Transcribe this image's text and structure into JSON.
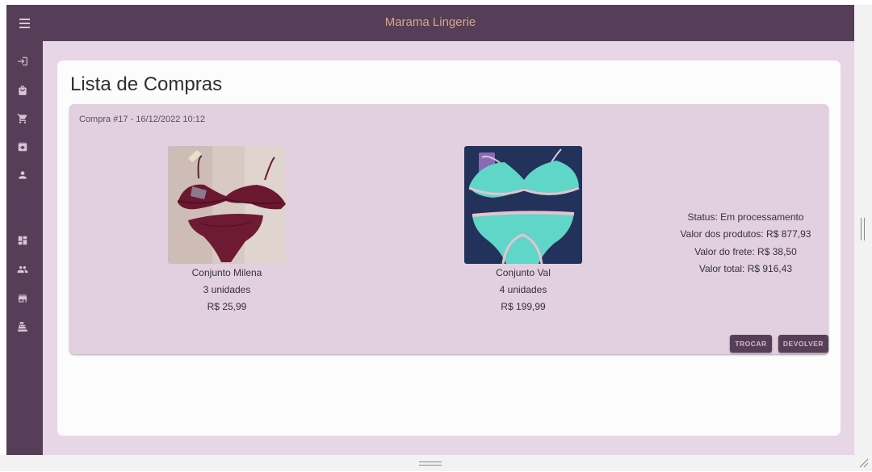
{
  "app": {
    "title": "Marama Lingerie"
  },
  "sidebar": {
    "items": [
      {
        "icon": "login-icon"
      },
      {
        "icon": "shopping-bag-icon"
      },
      {
        "icon": "cart-icon"
      },
      {
        "icon": "archive-icon"
      },
      {
        "icon": "person-icon"
      },
      {
        "icon": "dashboard-icon"
      },
      {
        "icon": "people-icon"
      },
      {
        "icon": "store-icon"
      },
      {
        "icon": "cash-register-icon"
      }
    ]
  },
  "page": {
    "title": "Lista de Compras"
  },
  "order": {
    "header": "Compra #17 - 16/12/2022 10:12",
    "products": [
      {
        "name": "Conjunto Milena",
        "quantity": "3 unidades",
        "price": "R$ 25,99",
        "image": "burgundy-lace-lingerie-set-photo"
      },
      {
        "name": "Conjunto Val",
        "quantity": "4 unidades",
        "price": "R$ 199,99",
        "image": "turquoise-lace-lingerie-set-photo"
      }
    ],
    "summary": {
      "status": "Status: Em processamento",
      "products_value": "Valor dos produtos: R$ 877,93",
      "shipping_value": "Valor do frete: R$ 38,50",
      "total_value": "Valor total: R$ 916,43"
    },
    "buttons": {
      "exchange": "TROCAR",
      "return": "DEVOLVER"
    }
  },
  "colors": {
    "primary": "#573e58",
    "title_accent": "#d1aa8d",
    "background": "#e7d6e5",
    "order_card": "#e2cfe0",
    "button_text": "#d4b7c9"
  }
}
